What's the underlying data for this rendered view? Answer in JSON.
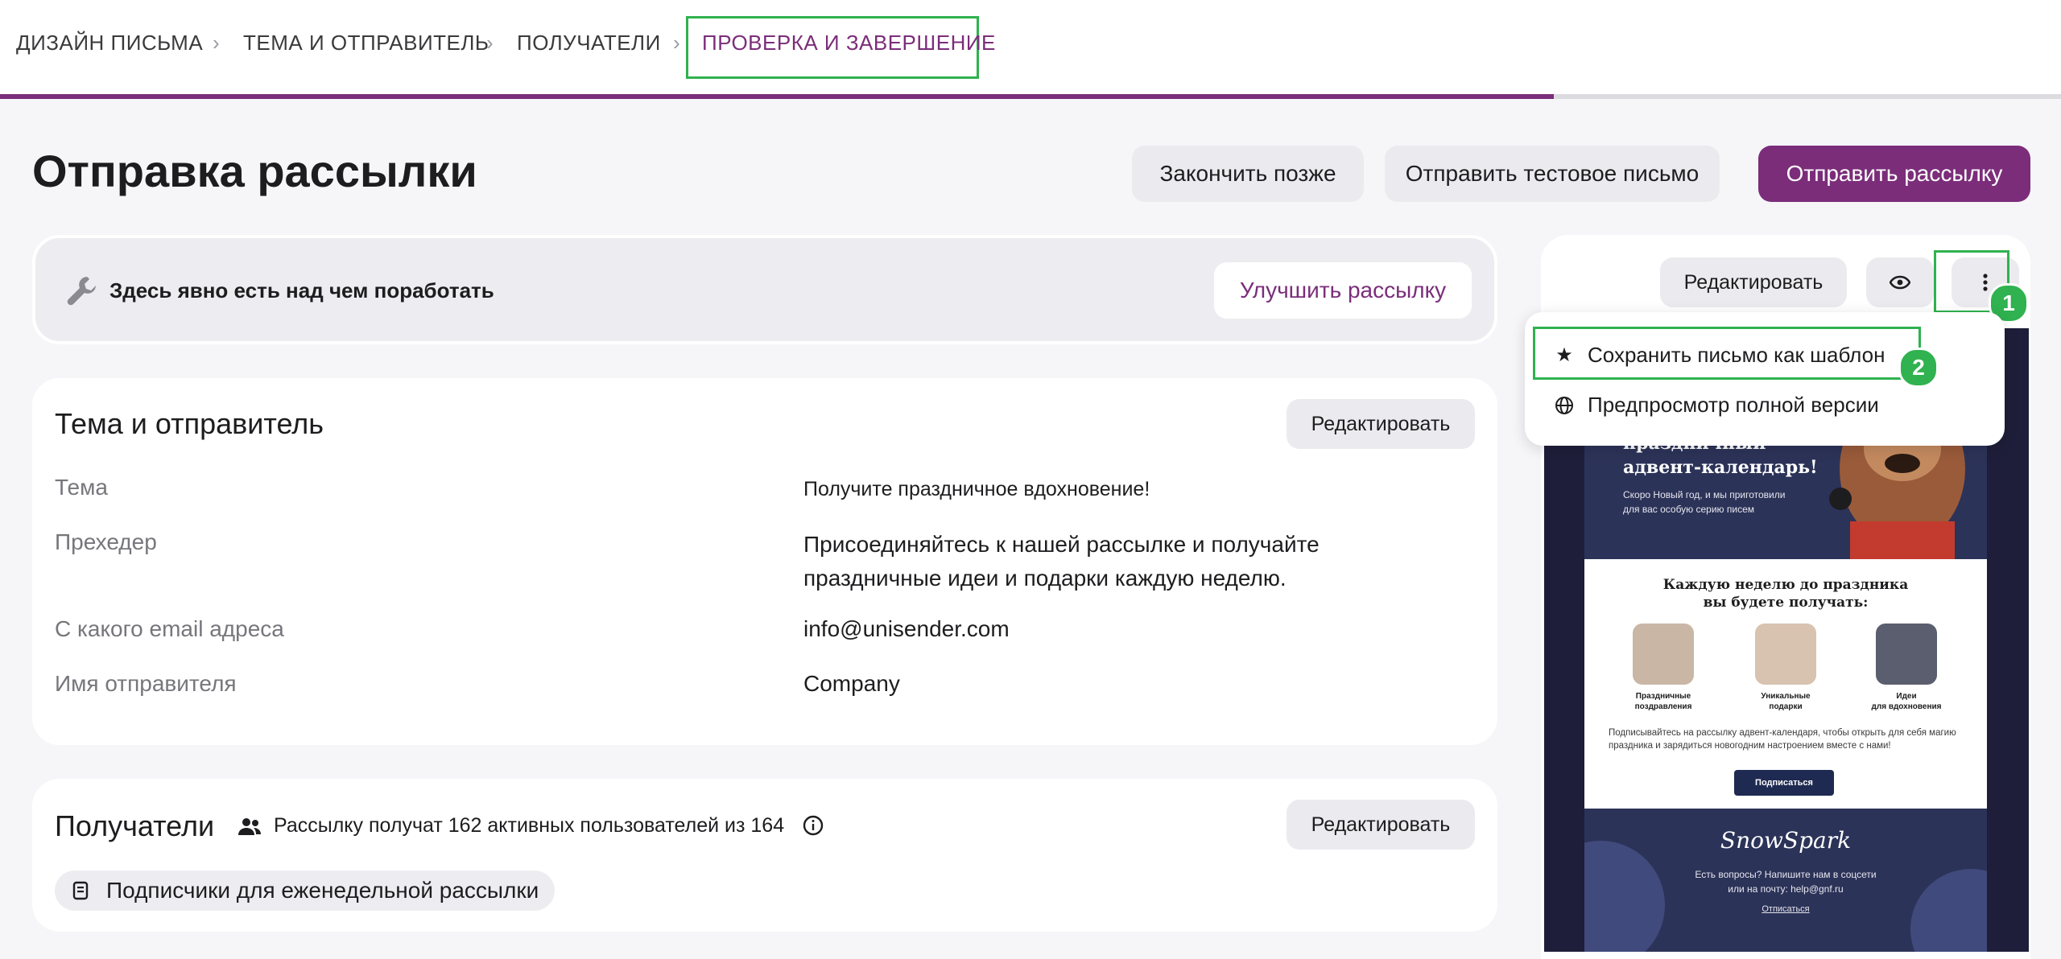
{
  "stepper": {
    "steps": [
      {
        "label": "ДИЗАЙН ПИСЬМА"
      },
      {
        "label": "ТЕМА И ОТПРАВИТЕЛЬ"
      },
      {
        "label": "ПОЛУЧАТЕЛИ"
      },
      {
        "label": "ПРОВЕРКА И ЗАВЕРШЕНИЕ"
      }
    ],
    "progress": 0.754
  },
  "page": {
    "title": "Отправка рассылки",
    "actions": {
      "finish_later": "Закончить позже",
      "send_test": "Отправить тестовое письмо",
      "send": "Отправить рассылку"
    }
  },
  "alert": {
    "text": "Здесь явно есть над чем поработать",
    "improve": "Улучшить рассылку"
  },
  "subject_card": {
    "title": "Тема и отправитель",
    "edit": "Редактировать",
    "rows": [
      {
        "label": "Тема",
        "value": "Получите праздничное вдохновение!"
      },
      {
        "label": "Прехедер",
        "value": "Присоединяйтесь к нашей рассылке и получайте праздничные идеи и подарки каждую неделю."
      },
      {
        "label": "С какого email адреса",
        "value": "info@unisender.com"
      },
      {
        "label": "Имя отправителя",
        "value": "Company"
      }
    ]
  },
  "recipients_card": {
    "title": "Получатели",
    "summary": "Рассылку получат 162 активных пользователей из 164",
    "edit": "Редактировать",
    "list_tag": "Подписчики для еженедельной рассылки"
  },
  "preview": {
    "edit": "Редактировать",
    "menu": {
      "save_template": "Сохранить письмо как шаблон",
      "full_preview": "Предпросмотр полной версии"
    },
    "badges": [
      "1",
      "2"
    ],
    "email": {
      "hero_line1": "праздничный",
      "hero_line2": "адвент-календарь!",
      "hero_sub1": "Скоро Новый год, и мы приготовили",
      "hero_sub2": "для вас особую серию писем",
      "heading1": "Каждую неделю до праздника",
      "heading2": "вы будете получать:",
      "items": [
        {
          "l1": "Праздничные",
          "l2": "поздравления"
        },
        {
          "l1": "Уникальные",
          "l2": "подарки"
        },
        {
          "l1": "Идеи",
          "l2": "для вдохновения"
        }
      ],
      "paragraph": "Подписывайтесь на рассылку адвент-календаря, чтобы открыть для себя магию праздника и зарядиться новогодним настроением вместе с нами!",
      "subscribe": "Подписаться",
      "logo": "SnowSpark",
      "footer1": "Есть вопросы? Напишите нам в соцсети",
      "footer2": "или на почту: help@gnf.ru",
      "unsubscribe": "Отписаться"
    }
  },
  "colors": {
    "accent": "#7b2d7a",
    "highlight": "#2fb24f"
  }
}
